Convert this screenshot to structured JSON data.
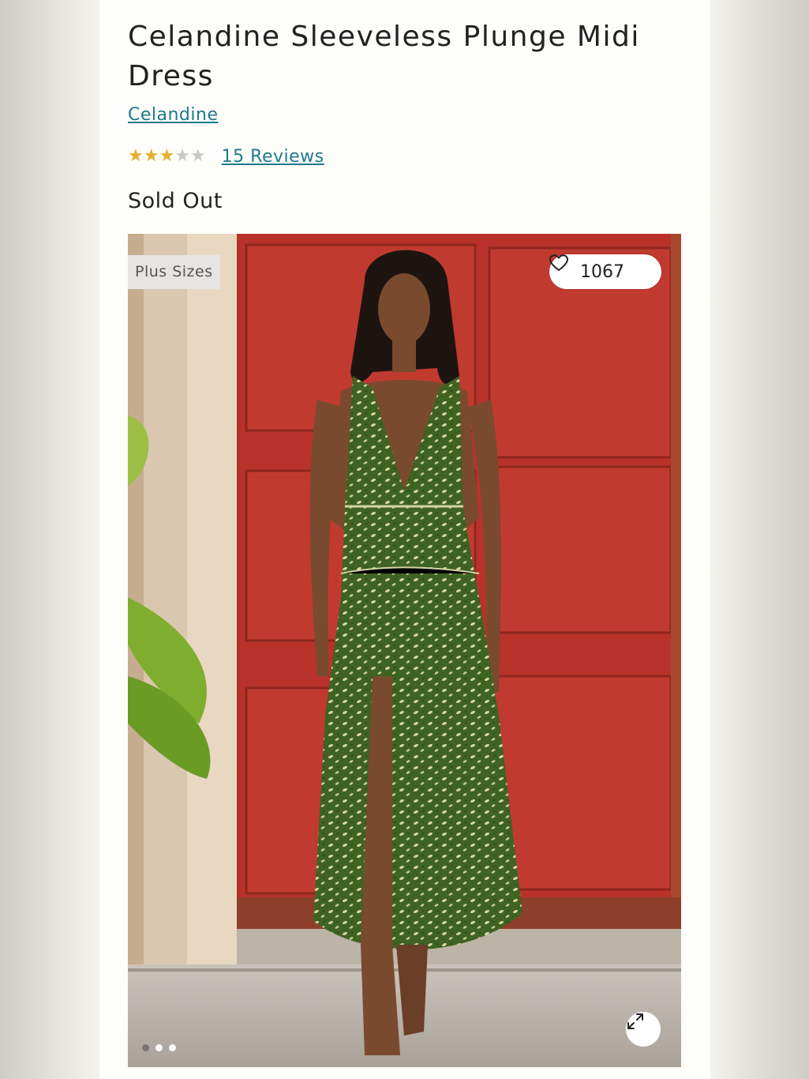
{
  "product": {
    "title": "Celandine Sleeveless Plunge Midi Dress",
    "brand": "Celandine",
    "rating": 3,
    "rating_max": 5,
    "reviews_label": "15 Reviews",
    "status": "Sold Out"
  },
  "image": {
    "badge": "Plus Sizes",
    "likes": "1067",
    "slide_count": 3,
    "active_slide": 1
  },
  "icons": {
    "like": "heart-icon",
    "expand": "expand-icon",
    "rating": "star-icon"
  },
  "colors": {
    "link": "#1f7a8c",
    "star_on": "#e4b02b",
    "star_off": "#c8c8c8",
    "door": "#b8302a",
    "dress": "#4a6b2a"
  }
}
